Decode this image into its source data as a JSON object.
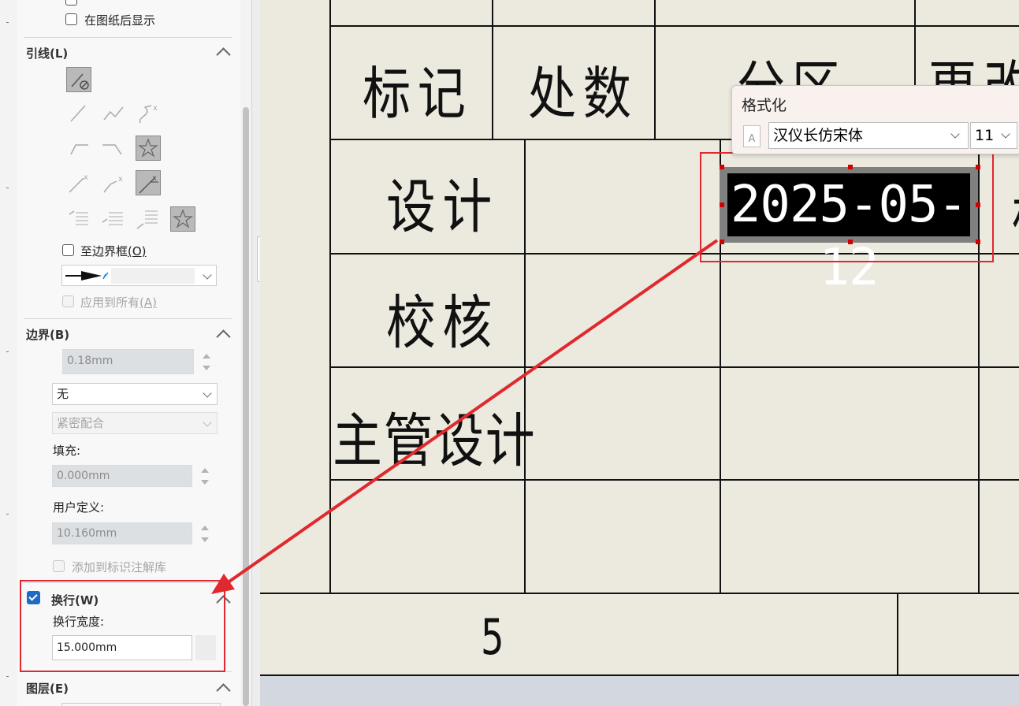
{
  "panel": {
    "top_partial_label": "",
    "show_behind_sheet": "在图纸后显示",
    "leader": {
      "title": "引线",
      "shortcut": "(L)",
      "to_boundary": "至边界框",
      "to_boundary_shortcut": "(O)",
      "apply_all": "应用到所有",
      "apply_all_shortcut": "(A)"
    },
    "border": {
      "title": "边界",
      "shortcut": "(B)",
      "thickness": "0.18mm",
      "style": "无",
      "fit": "紧密配合",
      "fill_label": "填充:",
      "fill_value": "0.000mm",
      "user_label": "用户定义:",
      "user_value": "10.160mm",
      "add_library": "添加到标识注解库"
    },
    "wrap": {
      "title": "换行",
      "shortcut": "(W)",
      "width_label": "换行宽度:",
      "width_value": "15.000mm",
      "checked": true
    },
    "layer": {
      "title": "图层",
      "shortcut": "(E)"
    }
  },
  "drawing": {
    "headers": [
      "标记",
      "处数",
      "分区",
      "更改"
    ],
    "row_labels": [
      "设计",
      "校核",
      "主管设计"
    ],
    "date": "2025-05-12",
    "bottom_value": "5",
    "right_partial": "标"
  },
  "format_popup": {
    "title": "格式化",
    "font": "汉仪长仿宋体",
    "size": "11"
  },
  "colors": {
    "annotation_red": "#e0282e",
    "accent_blue": "#1d6bc4",
    "sheet_bg": "#eceadf"
  }
}
